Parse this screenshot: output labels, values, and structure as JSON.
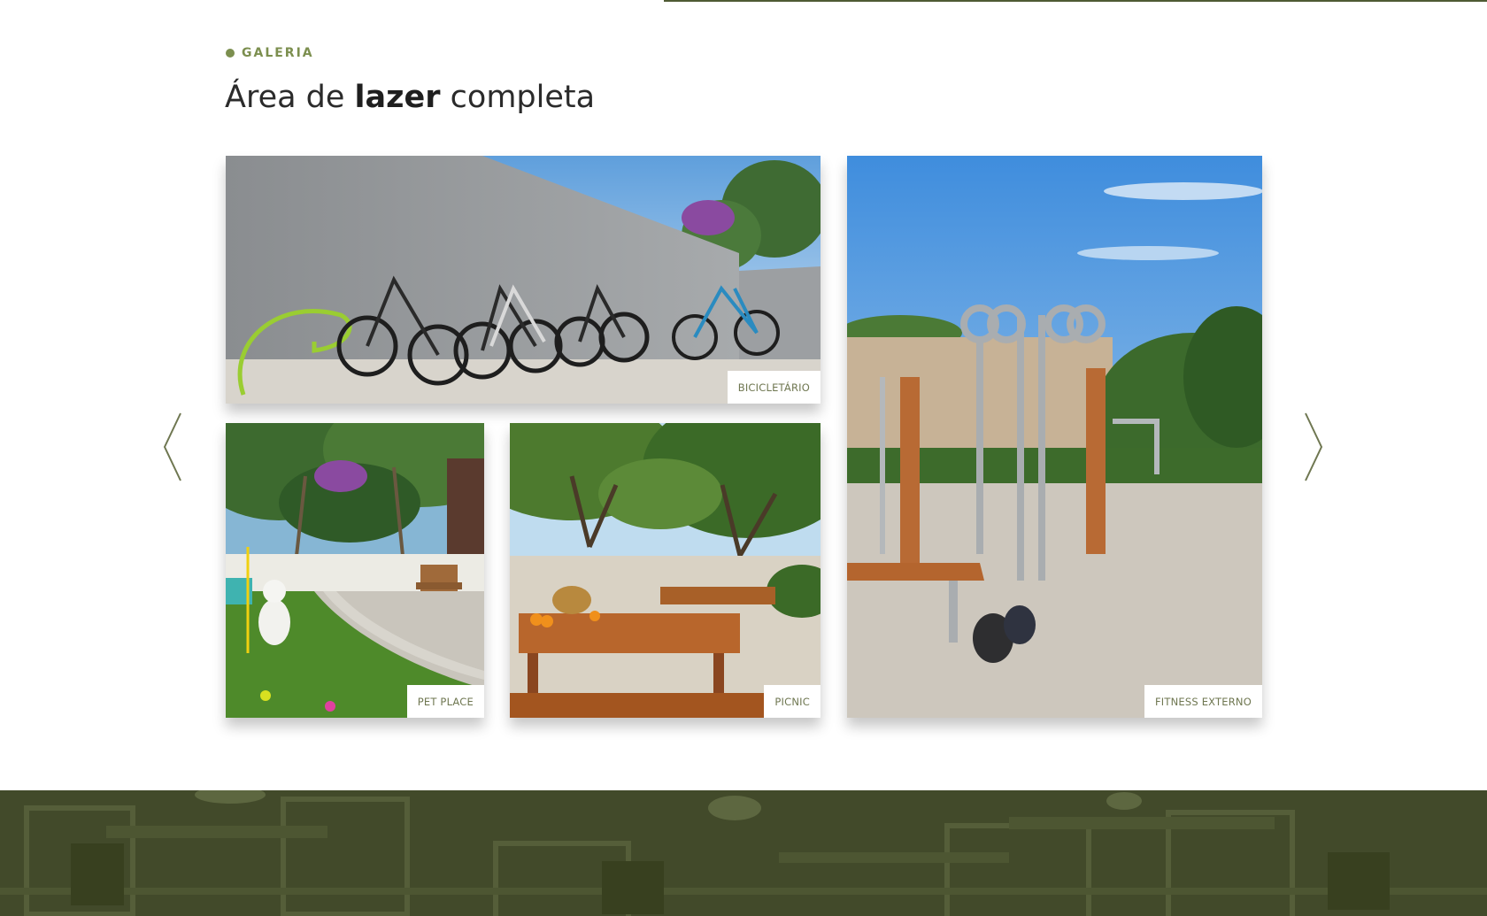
{
  "gallery": {
    "eyebrow": "GALERIA",
    "title_pre": "Área de ",
    "title_bold": "lazer",
    "title_post": " completa",
    "prev_icon": "chevron-left-icon",
    "next_icon": "chevron-right-icon",
    "items": [
      {
        "caption": "BICICLETÁRIO"
      },
      {
        "caption": "PET PLACE"
      },
      {
        "caption": "PICNIC"
      },
      {
        "caption": "FITNESS EXTERNO"
      }
    ]
  },
  "colors": {
    "accent": "#7c8f4f",
    "caption_text": "#6f7751",
    "band": "#424a2a",
    "top_rule": "#4f5a33"
  }
}
